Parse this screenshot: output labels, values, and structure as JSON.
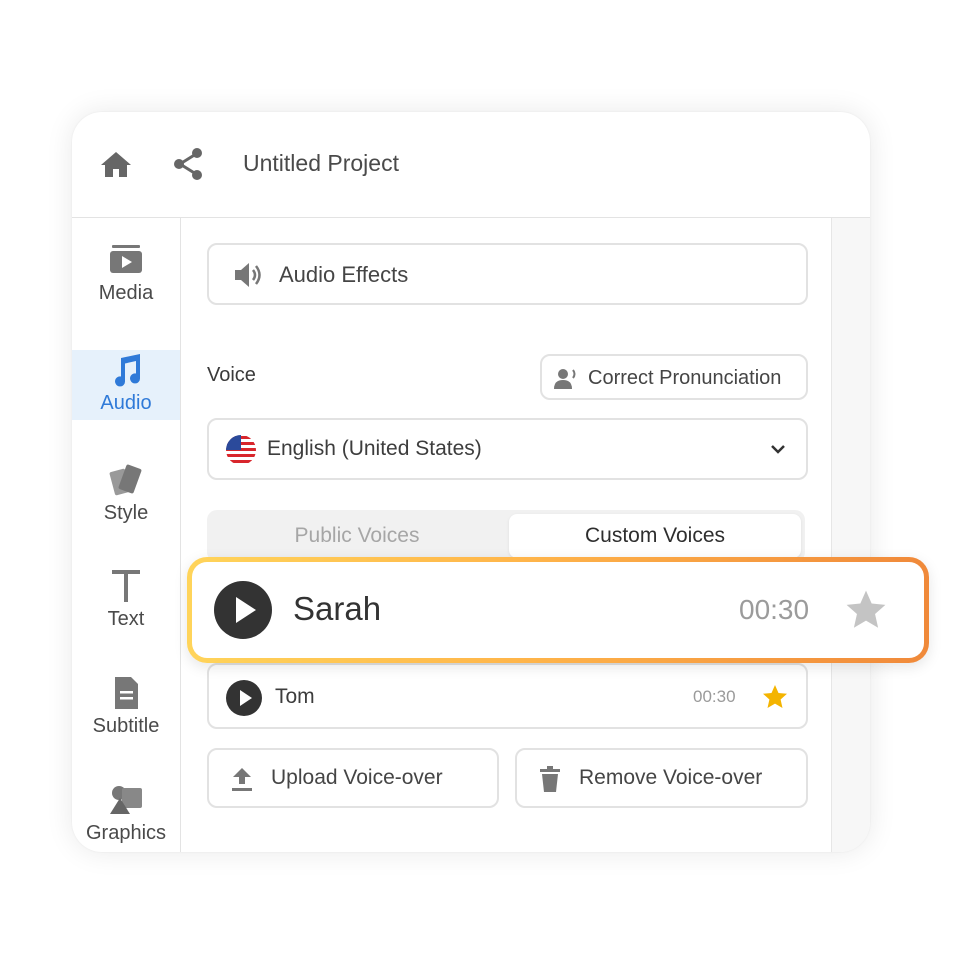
{
  "header": {
    "title": "Untitled Project",
    "home_icon": "home-icon",
    "share_icon": "share-icon"
  },
  "sidebar": {
    "items": [
      {
        "label": "Media",
        "icon": "media-icon"
      },
      {
        "label": "Audio",
        "icon": "music-note-icon",
        "active": true
      },
      {
        "label": "Style",
        "icon": "swatch-icon"
      },
      {
        "label": "Text",
        "icon": "text-t-icon"
      },
      {
        "label": "Subtitle",
        "icon": "document-icon"
      },
      {
        "label": "Graphics",
        "icon": "shapes-icon"
      }
    ]
  },
  "panel": {
    "audio_effects": "Audio Effects",
    "voice_label": "Voice",
    "correct_pronunciation": "Correct Pronunciation",
    "language": "English (United States)",
    "tabs": [
      {
        "label": "Public Voices"
      },
      {
        "label": "Custom Voices",
        "selected": true
      }
    ],
    "voices": [
      {
        "name": "Sarah",
        "duration": "00:30",
        "favorite": false,
        "highlighted": true
      },
      {
        "name": "Tom",
        "duration": "00:30",
        "favorite": true
      }
    ],
    "upload": "Upload Voice-over",
    "remove": "Remove Voice-over"
  },
  "colors": {
    "accent": "#2f7ad8",
    "active_bg": "#e6f1fb",
    "star_active": "#f4b400",
    "highlight_start": "#ffd45a",
    "highlight_end": "#f0893a"
  }
}
